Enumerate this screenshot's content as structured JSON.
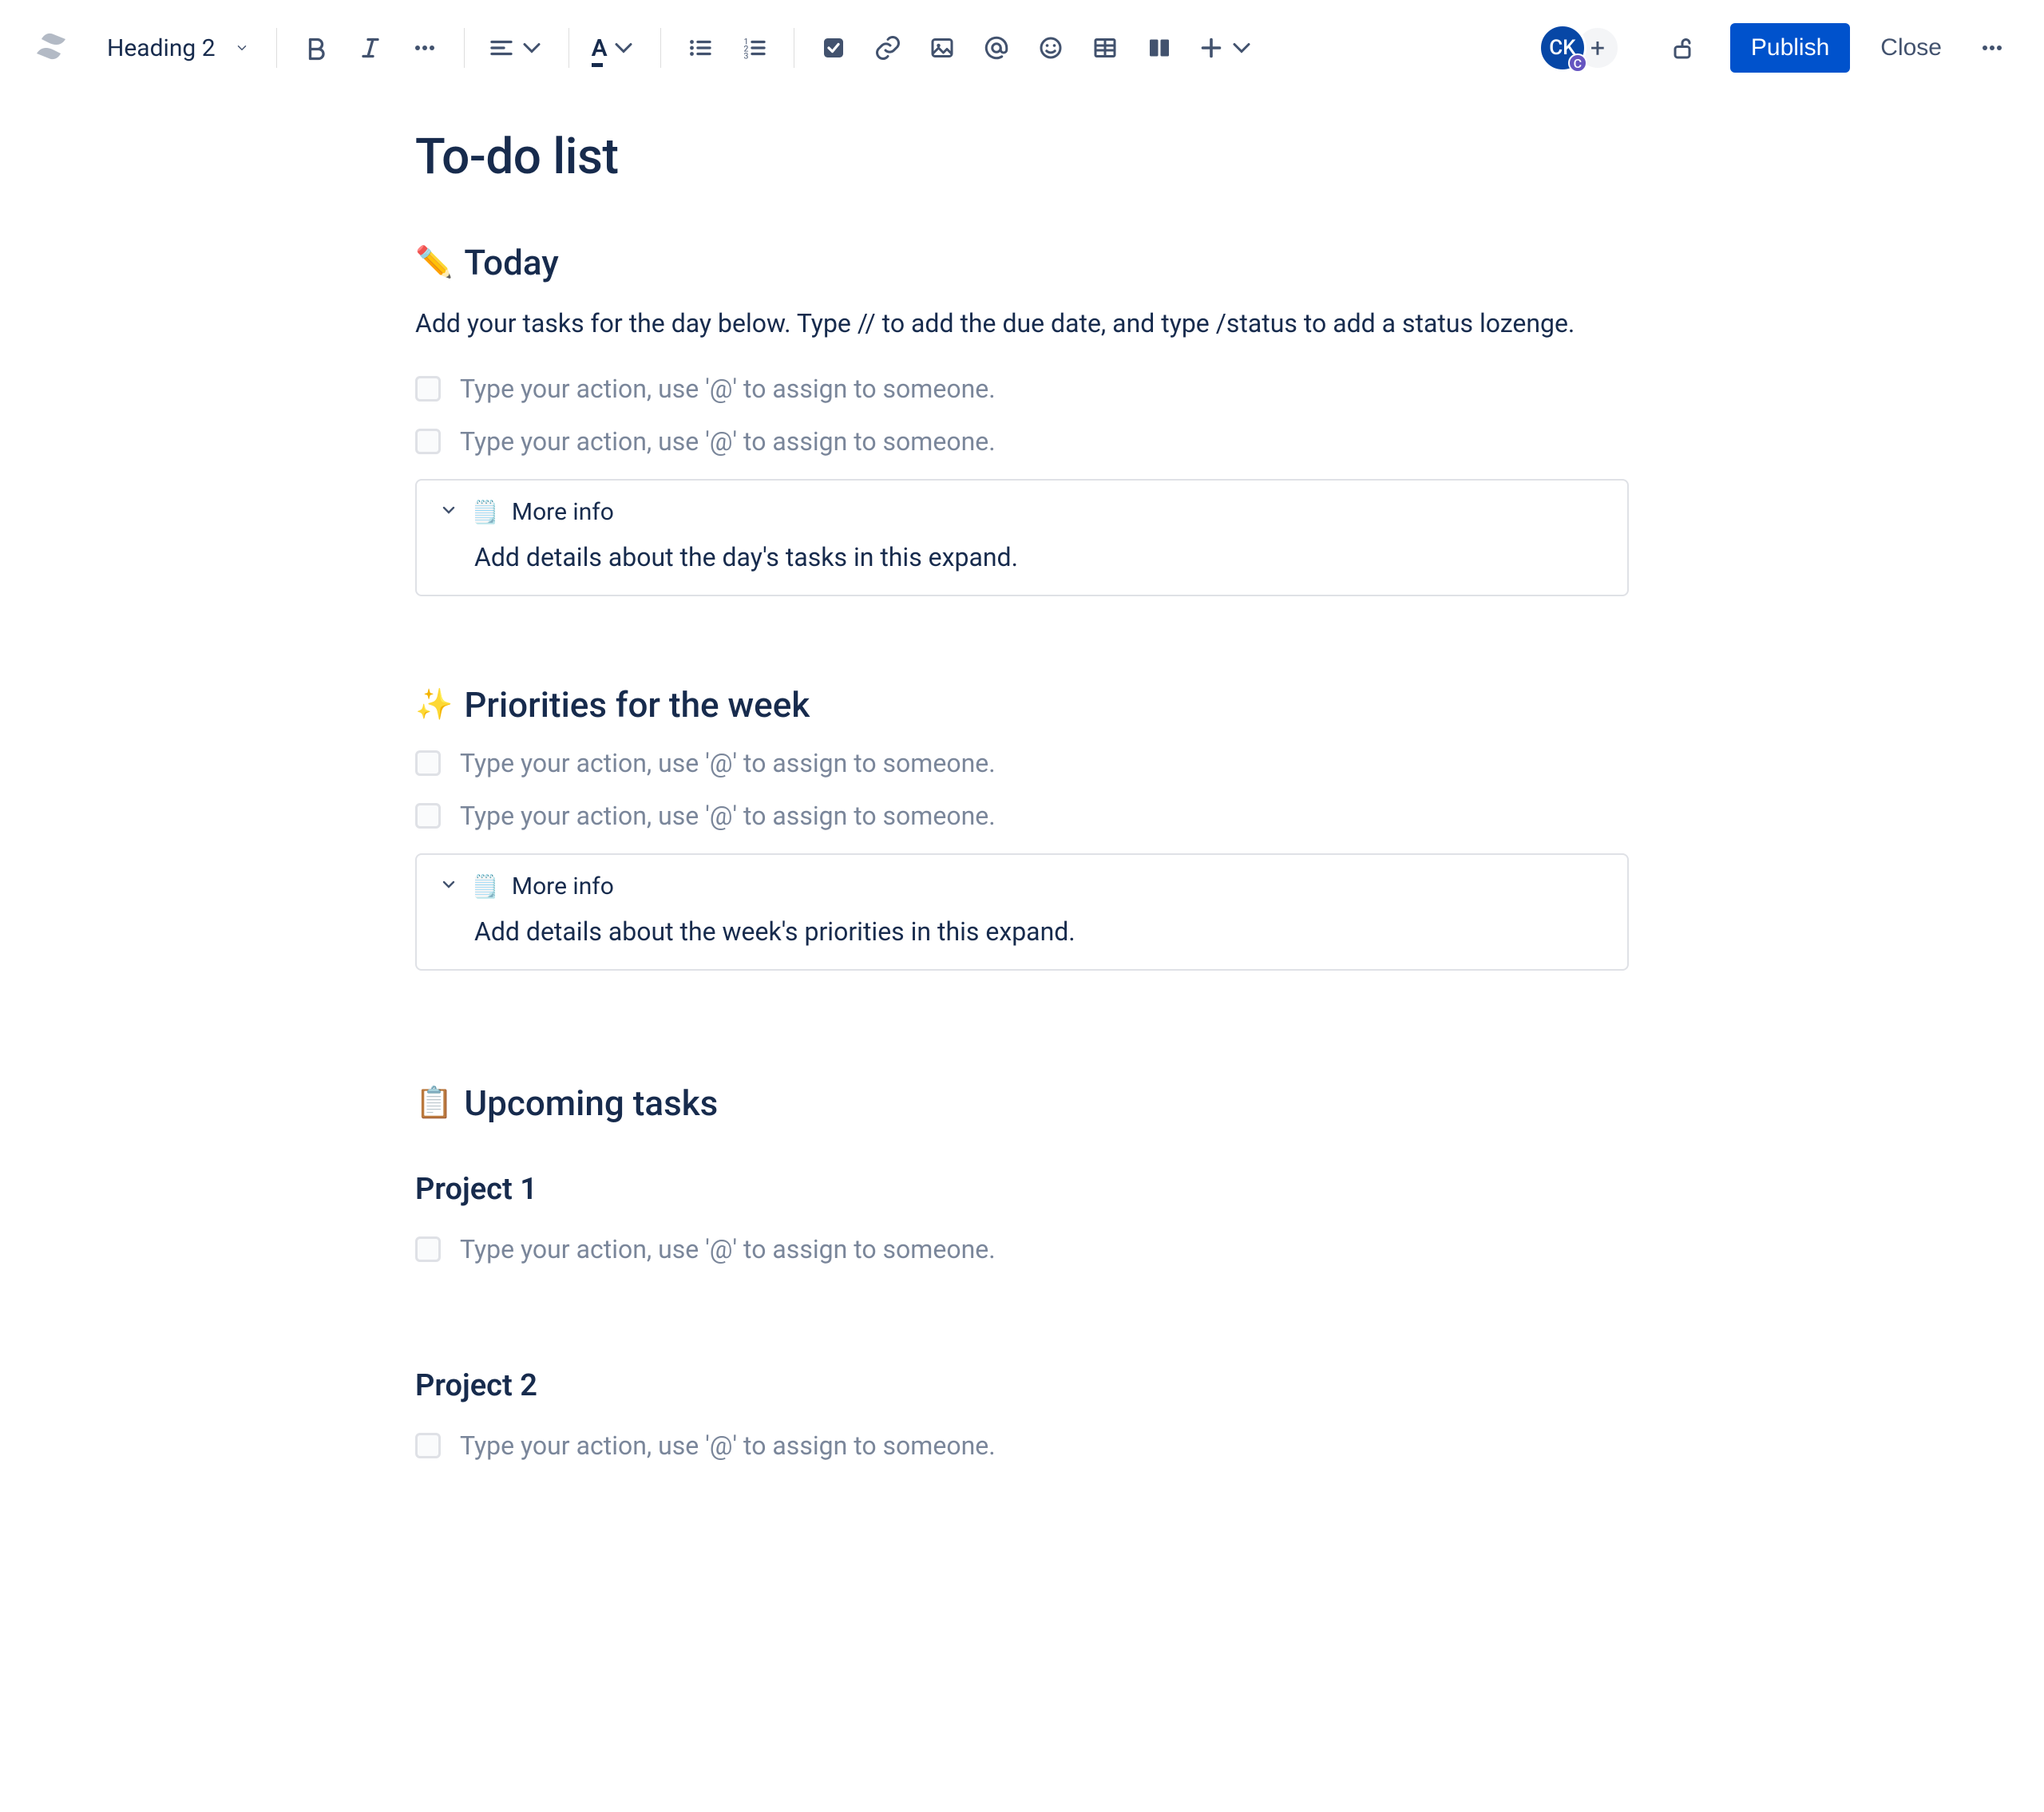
{
  "toolbar": {
    "heading_select": "Heading 2",
    "publish_label": "Publish",
    "close_label": "Close",
    "avatar_initials": "CK",
    "avatar_sub": "C"
  },
  "page": {
    "title": "To-do list"
  },
  "today": {
    "emoji": "✏️",
    "heading": "Today",
    "description": "Add your tasks for the day below. Type // to add the due date, and type /status to add a status lozenge.",
    "task_placeholder_1": "Type your action, use '@' to assign to someone.",
    "task_placeholder_2": "Type your action, use '@' to assign to someone.",
    "expand_title": "More info",
    "expand_body": "Add details about the day's tasks in this expand."
  },
  "week": {
    "emoji": "✨",
    "heading": "Priorities for the week",
    "task_placeholder_1": "Type your action, use '@' to assign to someone.",
    "task_placeholder_2": "Type your action, use '@' to assign to someone.",
    "expand_title": "More info",
    "expand_body": "Add details about the week's priorities in this expand."
  },
  "upcoming": {
    "emoji": "📋",
    "heading": "Upcoming tasks",
    "project1_title": "Project 1",
    "project1_task": "Type your action, use '@' to assign to someone.",
    "project2_title": "Project 2",
    "project2_task": "Type your action, use '@' to assign to someone."
  }
}
